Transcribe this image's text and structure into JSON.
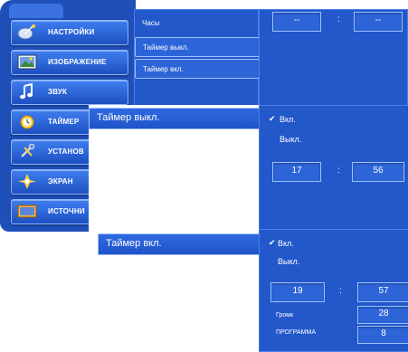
{
  "menu": {
    "items": [
      {
        "label": "НАСТРОЙКИ",
        "icon": "satellite-dish-icon"
      },
      {
        "label": "ИЗОБРАЖЕНИЕ",
        "icon": "picture-icon"
      },
      {
        "label": "ЗВУК",
        "icon": "music-note-icon"
      },
      {
        "label": "ТАЙМЕР",
        "icon": "clock-icon"
      },
      {
        "label": "УСТАНОВ",
        "icon": "tools-icon"
      },
      {
        "label": "ЭКРАН",
        "icon": "screen-icon"
      },
      {
        "label": "ИСТОЧНИ",
        "icon": "source-icon"
      }
    ]
  },
  "submenu": {
    "items": [
      "Часы",
      "Таймер выкл.",
      "Таймер вкл."
    ]
  },
  "clock": {
    "hours": "--",
    "colon": ":",
    "minutes": "--"
  },
  "off_timer": {
    "title": "Таймер выкл.",
    "option_on": "Вкл.",
    "option_off": "Выкл.",
    "check": "✔",
    "hours": "17",
    "colon": ":",
    "minutes": "56"
  },
  "on_timer": {
    "title": "Таймер вкл.",
    "option_on": "Вкл.",
    "option_off": "Выкл.",
    "check": "✔",
    "hours": "19",
    "colon": ":",
    "minutes": "57",
    "volume_label": "Громк",
    "volume_value": "28",
    "program_label": "ПРОГРАММА",
    "program_value": "8"
  },
  "colors": {
    "menu_blue": "#1f4fb8",
    "panel_blue": "#2358cb",
    "border_light": "#9ec0ff"
  }
}
